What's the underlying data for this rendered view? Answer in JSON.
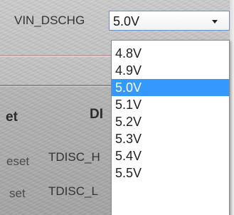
{
  "field": {
    "label": "VIN_DSCHG",
    "selected": "5.0V"
  },
  "dropdown": {
    "options": [
      "4.8V",
      "4.9V",
      "5.0V",
      "5.1V",
      "5.2V",
      "5.3V",
      "5.4V",
      "5.5V"
    ],
    "selected_index": 2
  },
  "background": {
    "heading_left": "et",
    "heading_right": "DI",
    "reset_label_1": "eset",
    "reset_label_2": "set",
    "tdisc_h_label": "TDISC_H",
    "tdisc_l_label": "TDISC_L"
  },
  "colors": {
    "selection": "#3399ff",
    "combo_border": "#6f8fbf"
  }
}
